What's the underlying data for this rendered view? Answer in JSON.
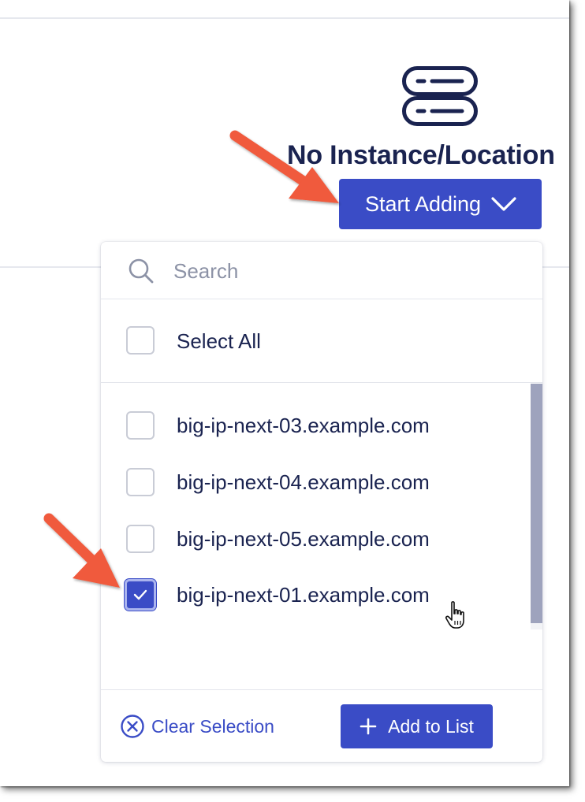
{
  "empty_state": {
    "icon": "server-icon",
    "title": "No Instance/Location"
  },
  "start_button": {
    "label": "Start Adding",
    "icon": "chevron-down-icon"
  },
  "dropdown": {
    "search": {
      "placeholder": "Search",
      "value": "",
      "icon": "search-icon"
    },
    "select_all": {
      "label": "Select All",
      "checked": false
    },
    "items": [
      {
        "label": "big-ip-next-03.example.com",
        "checked": false
      },
      {
        "label": "big-ip-next-04.example.com",
        "checked": false
      },
      {
        "label": "big-ip-next-05.example.com",
        "checked": false
      },
      {
        "label": "big-ip-next-01.example.com",
        "checked": true
      }
    ],
    "footer": {
      "clear_label": "Clear Selection",
      "clear_icon": "clear-circle-icon",
      "add_label": "Add to List",
      "add_icon": "plus-icon"
    }
  },
  "colors": {
    "accent": "#3a4cc6",
    "text_dark": "#1a2350",
    "placeholder": "#8c92a6",
    "annotation_arrow": "#f05a3c"
  }
}
